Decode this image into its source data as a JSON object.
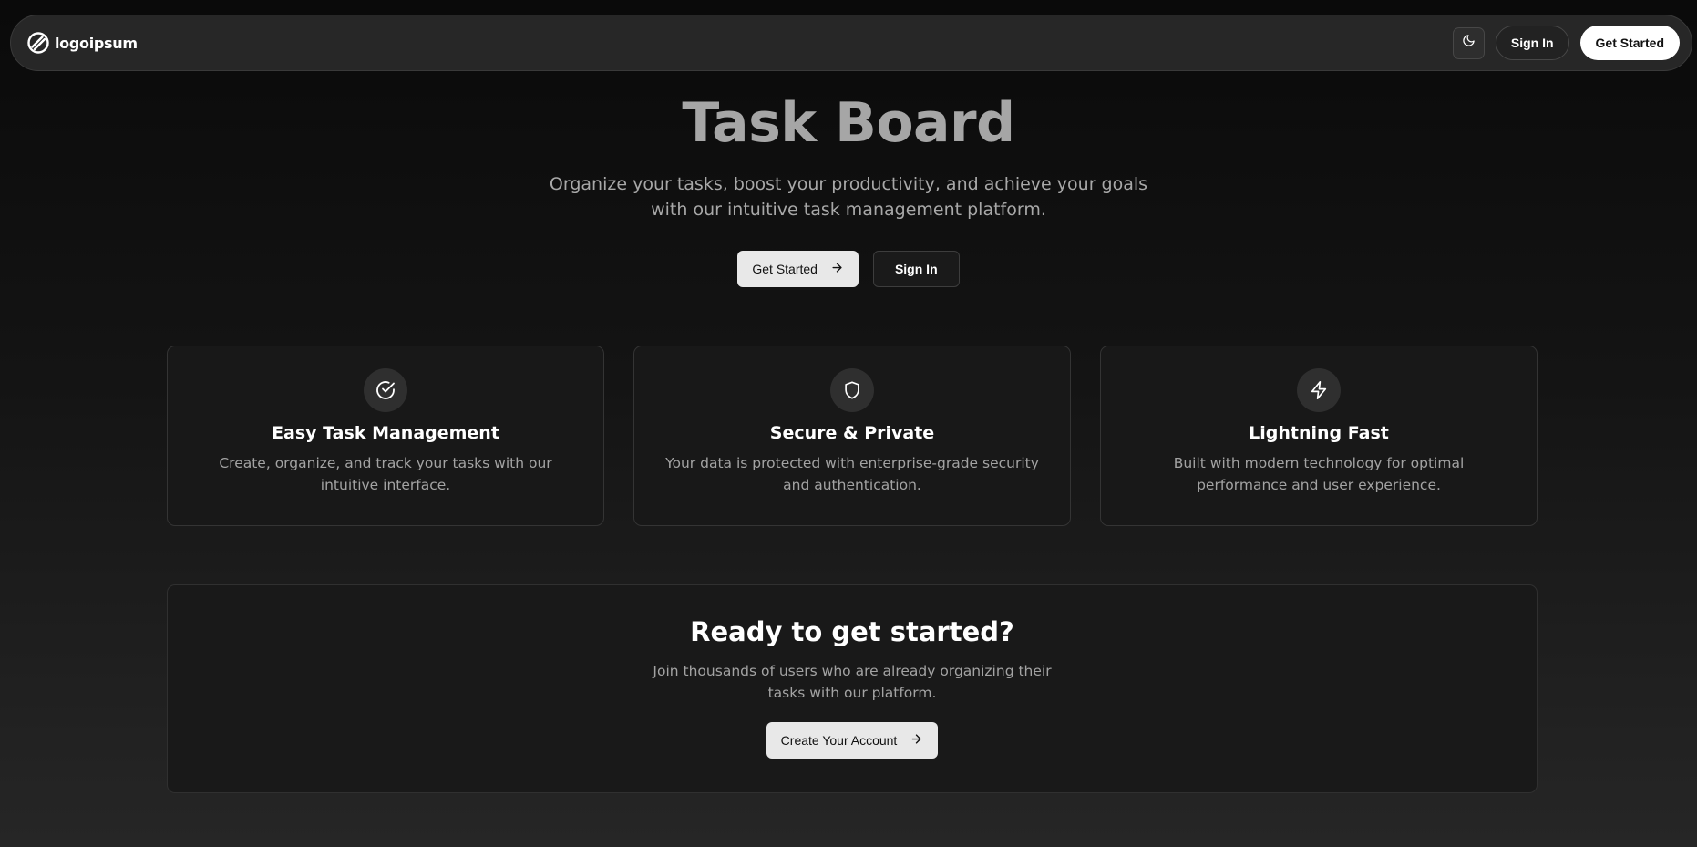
{
  "navbar": {
    "logo_icon": "logoipsum-icon",
    "brand_name": "logoipsum",
    "theme_toggle_icon": "moon-icon",
    "sign_in_label": "Sign In",
    "get_started_label": "Get Started"
  },
  "hero": {
    "title": "Task Board",
    "subtitle": "Organize your tasks, boost your productivity, and achieve your goals with our intuitive task management platform.",
    "primary_label": "Get Started",
    "primary_icon": "arrow-right-icon",
    "secondary_label": "Sign In"
  },
  "features": [
    {
      "icon": "circle-check-icon",
      "title": "Easy Task Management",
      "description": "Create, organize, and track your tasks with our intuitive interface."
    },
    {
      "icon": "shield-icon",
      "title": "Secure & Private",
      "description": "Your data is protected with enterprise-grade security and authentication."
    },
    {
      "icon": "lightning-icon",
      "title": "Lightning Fast",
      "description": "Built with modern technology for optimal performance and user experience."
    }
  ],
  "cta": {
    "title": "Ready to get started?",
    "description": "Join thousands of users who are already organizing their tasks with our platform.",
    "button_label": "Create Your Account",
    "button_icon": "arrow-right-icon"
  },
  "colors": {
    "background_top": "#0a0a0a",
    "background_bottom": "#262626",
    "card_background": "#181818",
    "card_border": "#343434",
    "hero_title": "#a6a6a6",
    "muted_text": "#a3a3a3",
    "light_button": "#e8e8e8"
  }
}
